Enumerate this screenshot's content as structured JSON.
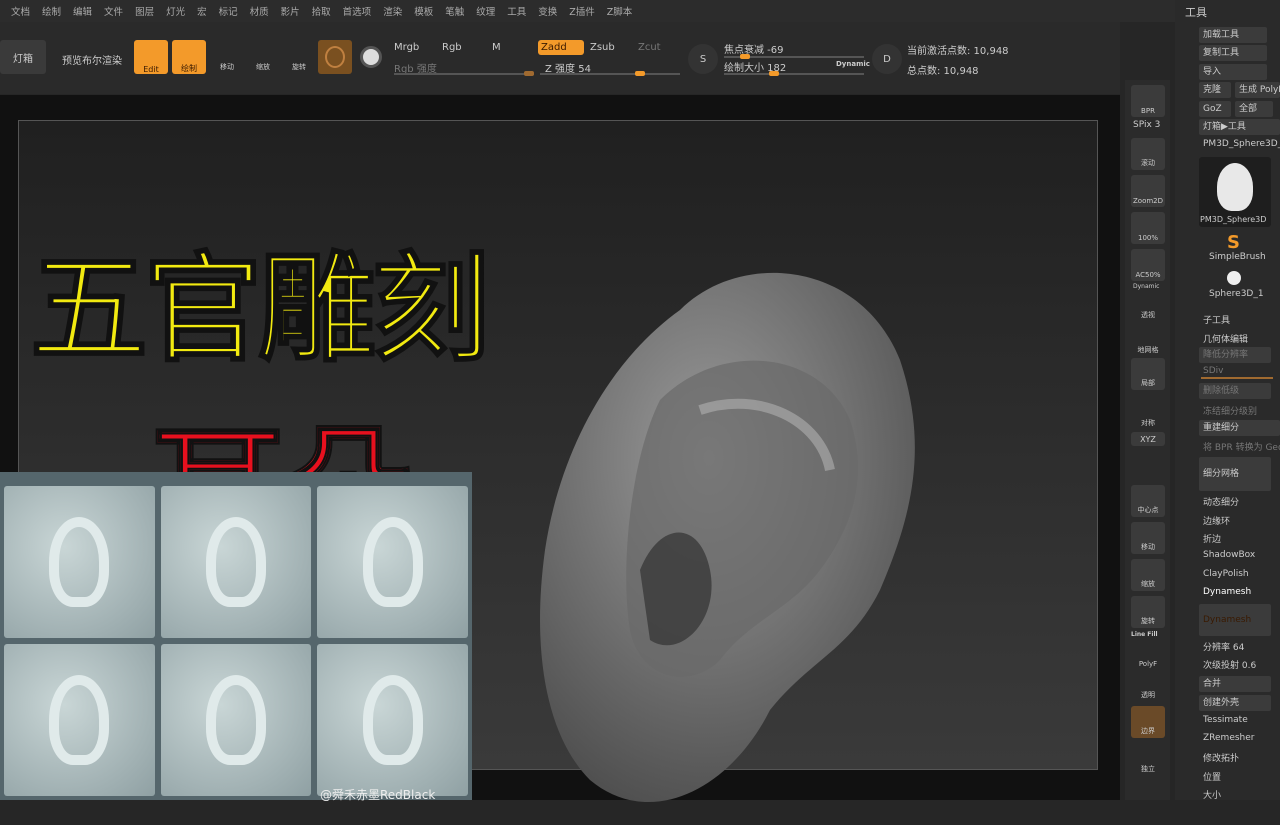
{
  "menu": [
    "文档",
    "绘制",
    "编辑",
    "文件",
    "图层",
    "灯光",
    "宏",
    "标记",
    "材质",
    "影片",
    "拾取",
    "首选项",
    "渲染",
    "模板",
    "笔触",
    "纹理",
    "工具",
    "变换",
    "Z插件",
    "Z脚本"
  ],
  "toolbar": {
    "lightbox": "灯箱",
    "preview_bool": "预览布尔渲染",
    "edit": "Edit",
    "draw": "绘制",
    "move": "移动",
    "scale": "缩放",
    "rotate": "旋转",
    "mrgb": "Mrgb",
    "rgb": "Rgb",
    "m": "M",
    "zadd": "Zadd",
    "zsub": "Zsub",
    "zcut": "Zcut",
    "rgb_intensity": "Rgb 强度",
    "z_intensity": "Z 强度 54",
    "focal_shift": "焦点衰减 -69",
    "draw_size": "绘制大小 182",
    "dynamic": "Dynamic",
    "active_points": "当前激活点数: 10,948",
    "total_points": "总点数: 10,948"
  },
  "overlay": {
    "title": "五官雕刻",
    "subtitle": "耳朵",
    "watermark": "@舜禾赤墨RedBlack"
  },
  "shelf": {
    "bpr": "BPR",
    "spix": "SPix 3",
    "scroll": "滚动",
    "zoom2d": "Zoom2D",
    "p100": "100%",
    "ac50": "AC50%",
    "dynamic": "Dynamic",
    "persp": "透视",
    "floor": "地网格",
    "local": "局部",
    "sym": "对称",
    "xyz": "XYZ",
    "center": "中心点",
    "move": "移动",
    "scale": "缩放",
    "rotate": "旋转",
    "linefill": "Line Fill",
    "polyf": "PolyF",
    "transp": "透明",
    "ghost": "边界",
    "solo": "独立"
  },
  "panel": {
    "title": "工具",
    "load": "加载工具",
    "copy": "复制工具",
    "import": "导入",
    "clone": "克隆",
    "make_poly": "生成 PolyM",
    "goz": "GoZ",
    "all": "全部",
    "lightbox_tool": "灯箱▶工具",
    "current_tool": "PM3D_Sphere3D_",
    "thumb_label": "PM3D_Sphere3D",
    "simplebrush": "SimpleBrush",
    "sphere": "Sphere3D_1",
    "subtool": "子工具",
    "geometry": "几何体编辑",
    "lower_res": "降低分辨率",
    "sdiv": "SDiv",
    "del_lower": "删除低级",
    "freeze": "冻结细分级别",
    "rebuild": "重建细分",
    "bpr_geo": "将 BPR 转换为 Geo",
    "divide": "细分网格",
    "dyn_sub": "动态细分",
    "edgeloop": "边缘环",
    "crease": "折边",
    "shadowbox": "ShadowBox",
    "claypolish": "ClayPolish",
    "dynamesh_h": "Dynamesh",
    "dynamesh_btn": "Dynamesh",
    "resolution": "分辨率 64",
    "subproj": "次级投射 0.6",
    "merge": "合并",
    "shell": "创建外壳",
    "tessimate": "Tessimate",
    "zremesher": "ZRemesher",
    "topology": "修改拓扑",
    "position": "位置",
    "size": "大小"
  },
  "colors": {
    "accent": "#f39a2a",
    "title_yellow": "#f2ea10",
    "title_red": "#e8101e"
  }
}
